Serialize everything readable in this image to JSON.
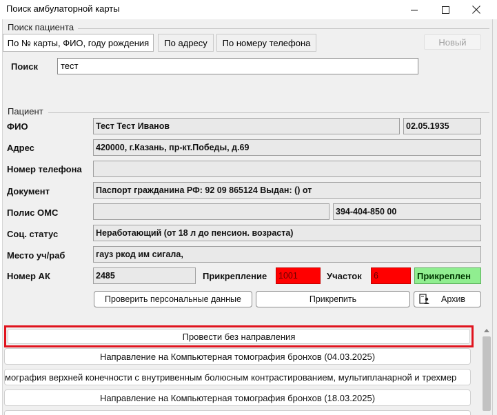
{
  "window": {
    "title": "Поиск амбулаторной карты"
  },
  "search": {
    "group_label": "Поиск пациента",
    "tabs": [
      {
        "label": "По № карты, ФИО, году рождения",
        "active": true
      },
      {
        "label": "По адресу",
        "active": false
      },
      {
        "label": "По номеру телефона",
        "active": false
      }
    ],
    "new_button": "Новый",
    "search_label": "Поиск",
    "search_value": "тест"
  },
  "patient": {
    "group_label": "Пациент",
    "fio_label": "ФИО",
    "fio": "Тест Тест Иванов",
    "birth_date": "02.05.1935",
    "address_label": "Адрес",
    "address": "420000, г.Казань, пр-кт.Победы, д.69",
    "phone_label": "Номер телефона",
    "phone": "",
    "document_label": "Документ",
    "document": "Паспорт гражданина РФ: 92 09 865124 Выдан: () от",
    "oms_label": "Полис ОМС",
    "oms_series": "",
    "oms_number": "394-404-850 00",
    "social_label": "Соц. статус",
    "social": "Неработающий (от 18 л до пенсион. возраста)",
    "work_label": "Место уч/раб",
    "work": "гауз ркод им сигала,",
    "ak_label": "Номер АК",
    "ak": "2485",
    "attach_label": "Прикрепление",
    "attach_value": "1001",
    "uchastok_label": "Участок",
    "uchastok_value": "6",
    "attach_status": "Прикреплен",
    "check_button": "Проверить персональные данные",
    "attach_button": "Прикрепить",
    "archive_button": "Архив"
  },
  "list": {
    "items": [
      "Провести без направления",
      "Направление на Компьютерная томография бронхов (04.03.2025)",
      "мография верхней конечности с внутривенным болюсным контрастированием, мультипланарной и трехмер",
      "Направление на Компьютерная томография бронхов (18.03.2025)"
    ]
  },
  "colors": {
    "highlight_border": "#e0141e",
    "attach_red": "#ff0000",
    "status_green": "#90ee90"
  }
}
